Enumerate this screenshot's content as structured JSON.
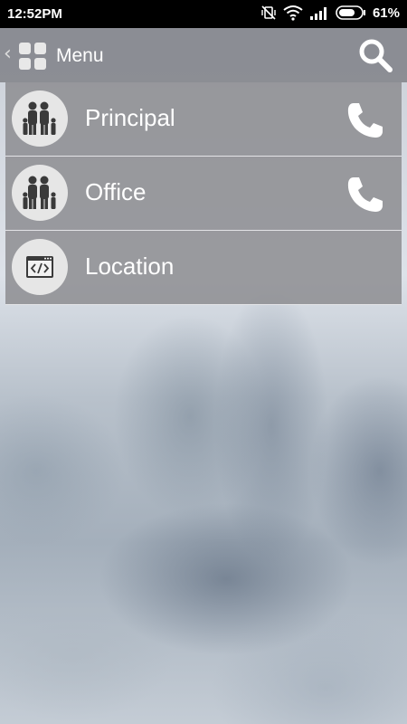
{
  "status_bar": {
    "time": "12:52PM",
    "battery": "61%",
    "icons": [
      "vibrate-off-icon",
      "wifi-icon",
      "signal-icon",
      "battery-icon"
    ]
  },
  "header": {
    "title": "Menu",
    "back_icon": "chevron-left-icon",
    "menu_icon": "grid-icon",
    "search_icon": "search-icon"
  },
  "menu": {
    "items": [
      {
        "label": "Principal",
        "icon": "family-icon",
        "action_icon": "phone-icon"
      },
      {
        "label": "Office",
        "icon": "family-icon",
        "action_icon": "phone-icon"
      },
      {
        "label": "Location",
        "icon": "code-window-icon"
      }
    ]
  },
  "colors": {
    "status_bar": "#000000",
    "header_bg": "#7a7c80",
    "list_bg": "#8a8a8e",
    "avatar_bg": "#e6e6e6",
    "text": "#ffffff"
  }
}
